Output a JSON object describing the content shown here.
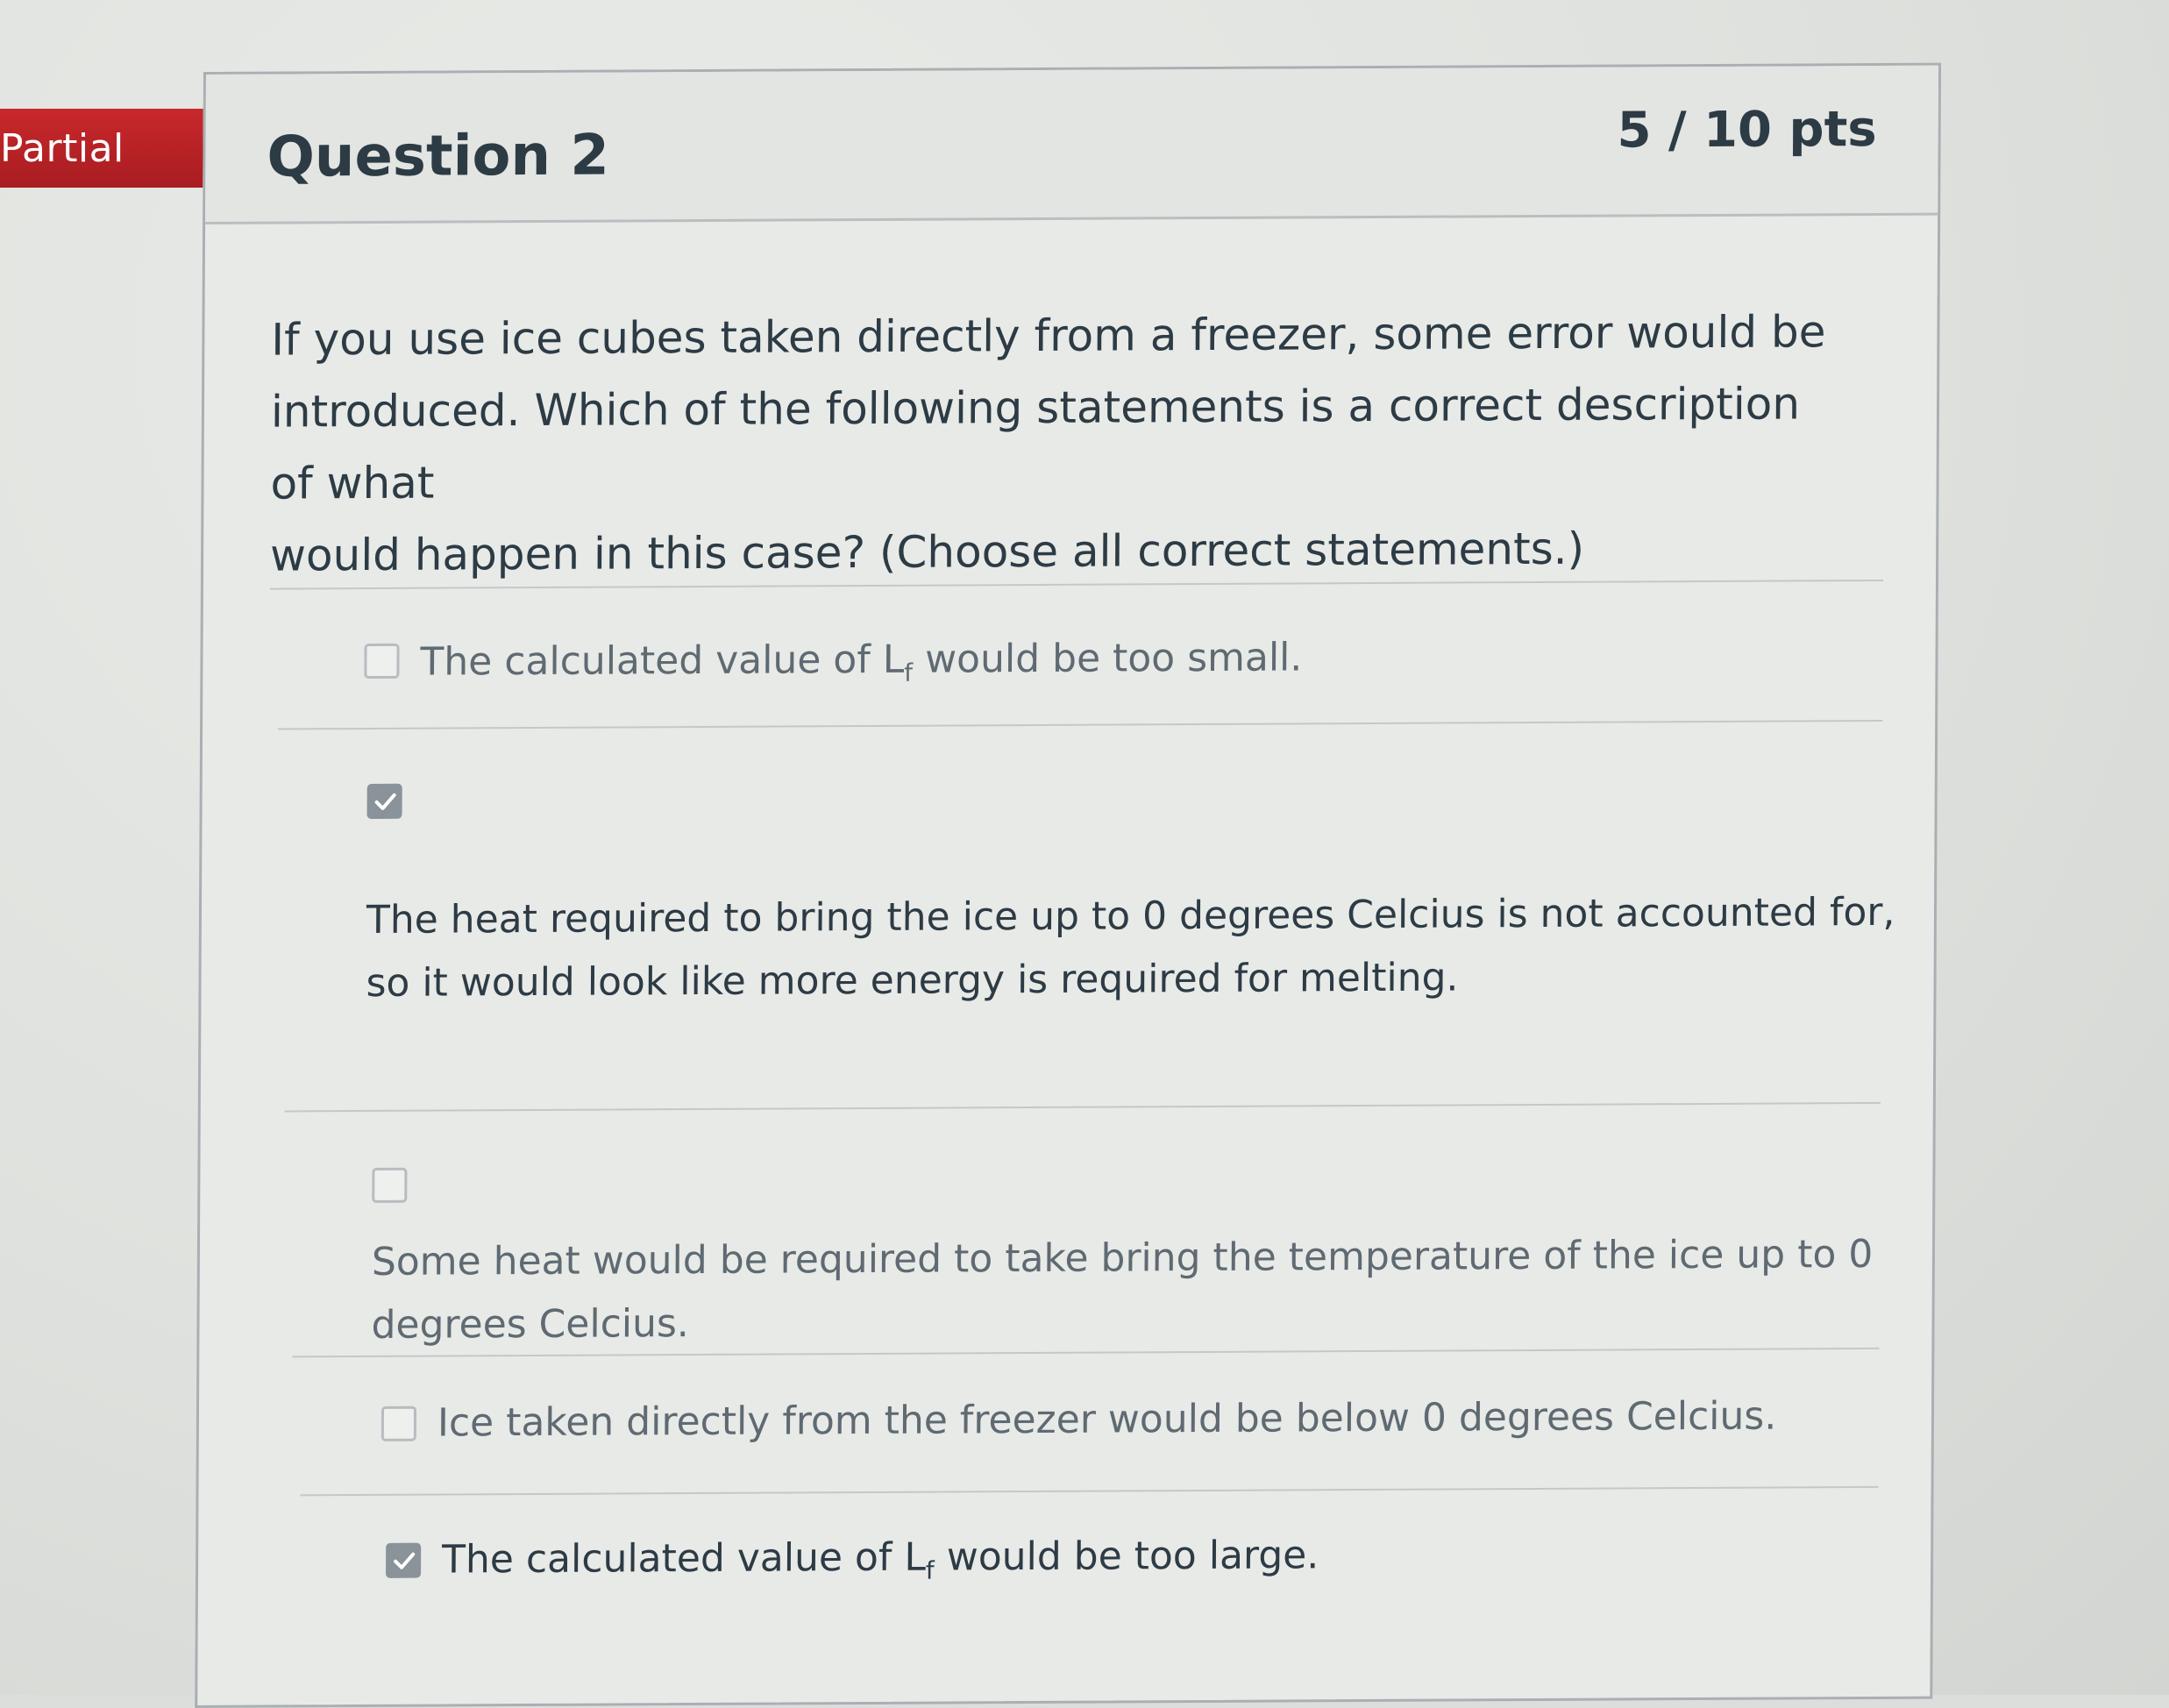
{
  "grade_status": "Partial",
  "question": {
    "title": "Question 2",
    "points": "5 / 10 pts",
    "text_line1": "If you use ice cubes taken directly from a freezer, some error would be",
    "text_line2": "introduced. Which of the following statements is a correct description of what",
    "text_line3": "would happen in this case? (Choose all correct statements.)"
  },
  "answers": [
    {
      "checked": false,
      "text_before": "The calculated value of L",
      "subscript": "f",
      "text_after": " would be too small."
    },
    {
      "checked": true,
      "line1": "The heat required to bring the ice up to 0 degrees Celcius is not accounted for,",
      "line2": "so it would look like more energy is required for melting."
    },
    {
      "checked": false,
      "line1": "Some heat would be required to take bring the temperature of the ice up to 0",
      "line2": "degrees Celcius."
    },
    {
      "checked": false,
      "text": "Ice taken directly from the freezer would be below 0 degrees Celcius."
    },
    {
      "checked": true,
      "text_before": "The calculated value of L",
      "subscript": "f",
      "text_after": " would be too large."
    }
  ],
  "colors": {
    "ribbon": "#b82226",
    "text": "#2d3b45",
    "muted_text": "#5f6a72",
    "checkbox_checked": "#8a9399"
  },
  "icons": [
    "checkmark-icon"
  ]
}
